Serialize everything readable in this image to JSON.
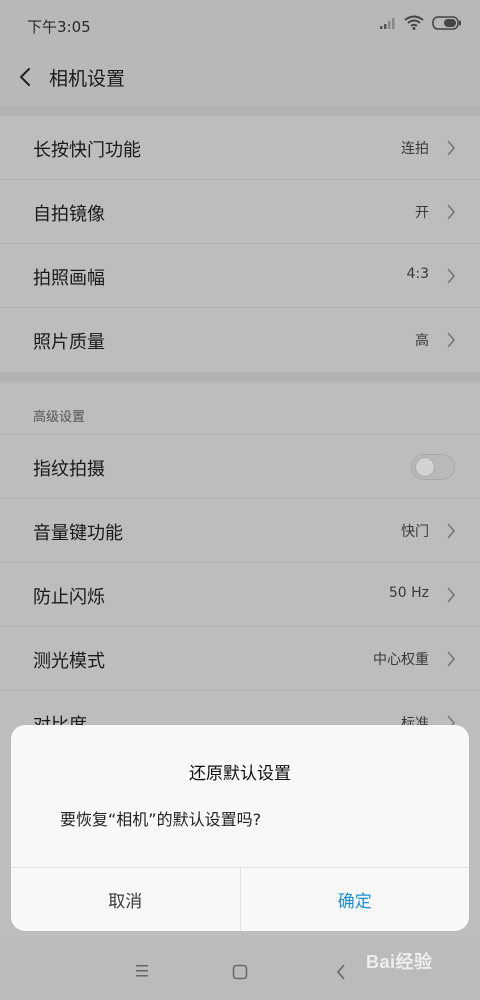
{
  "status_bar": {
    "time": "下午3:05"
  },
  "header": {
    "title": "相机设置"
  },
  "groups": [
    {
      "rows": [
        {
          "label": "长按快门功能",
          "value": "连拍"
        },
        {
          "label": "自拍镜像",
          "value": "开"
        },
        {
          "label": "拍照画幅",
          "value": "4:3"
        },
        {
          "label": "照片质量",
          "value": "高"
        }
      ]
    },
    {
      "header": "高级设置",
      "rows": [
        {
          "label": "指纹拍摄",
          "toggle": false
        },
        {
          "label": "音量键功能",
          "value": "快门"
        },
        {
          "label": "防止闪烁",
          "value": "50 Hz"
        },
        {
          "label": "测光模式",
          "value": "中心权重"
        },
        {
          "label": "对比度",
          "value": "标准"
        }
      ]
    }
  ],
  "dialog": {
    "title": "还原默认设置",
    "message": "要恢复“相机”的默认设置吗?",
    "cancel_label": "取消",
    "confirm_label": "确定"
  },
  "watermark": {
    "text": "Bai经验"
  },
  "colors": {
    "accent": "#1a8fd6",
    "dialog_bg": "#f8f8f8",
    "dim_bg": "#bdbdbd"
  }
}
